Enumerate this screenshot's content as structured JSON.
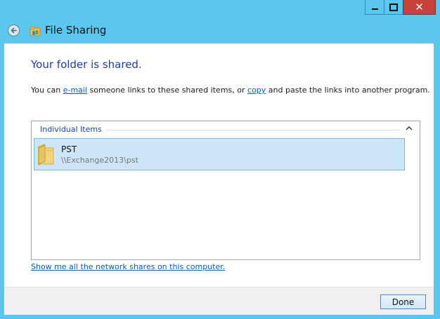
{
  "window": {
    "title": "File Sharing",
    "controls": {
      "minimize": "minimize",
      "maximize": "maximize",
      "close": "close"
    }
  },
  "content": {
    "heading": "Your folder is shared.",
    "desc_prefix": "You can ",
    "email_link": "e-mail",
    "desc_middle": " someone links to these shared items, or ",
    "copy_link": "copy",
    "desc_suffix": " and paste the links into another program."
  },
  "list": {
    "group_header": "Individual Items",
    "items": [
      {
        "name": "PST",
        "path": "\\\\Exchange2013\\pst"
      }
    ]
  },
  "network_link": "Show me all the network shares on this computer.",
  "footer": {
    "done_label": "Done"
  },
  "colors": {
    "frame": "#5bc7ee",
    "close_button": "#c7403a",
    "heading": "#1f3e9a",
    "link": "#0b59b3",
    "selection": "#cde6f7"
  }
}
